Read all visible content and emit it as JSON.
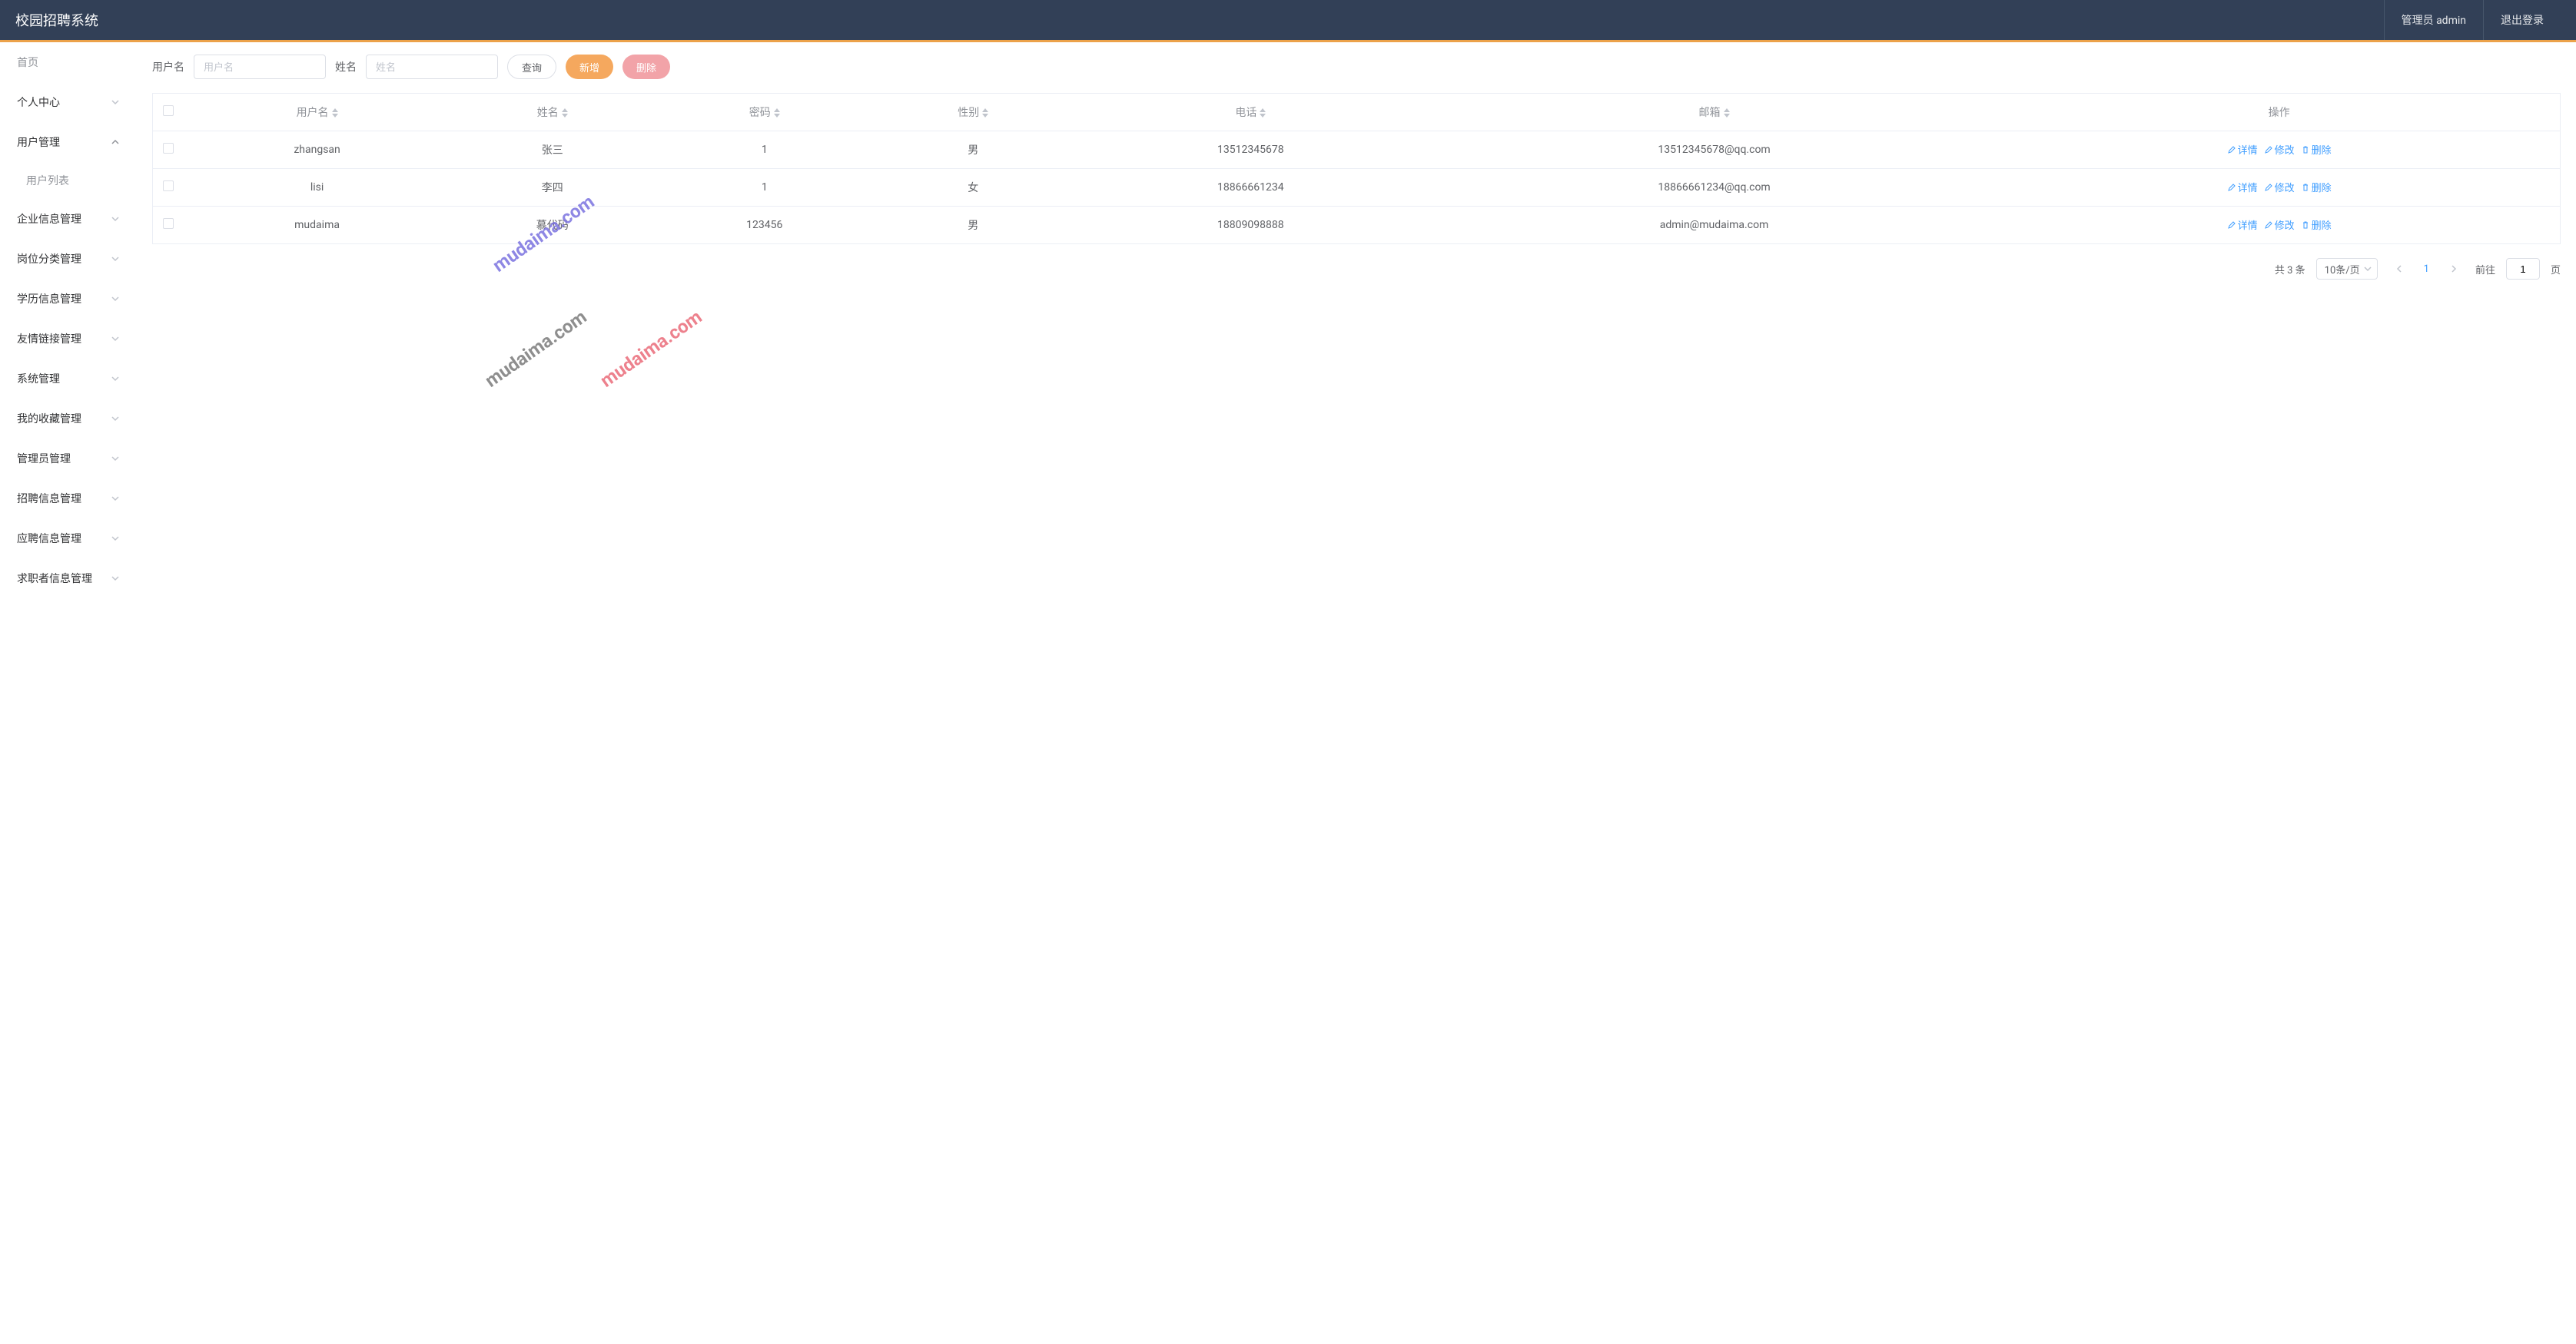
{
  "header": {
    "title": "校园招聘系统",
    "admin_label": "管理员 admin",
    "logout_label": "退出登录"
  },
  "sidebar": {
    "home_label": "首页",
    "groups": [
      {
        "label": "个人中心",
        "expanded": false
      },
      {
        "label": "用户管理",
        "expanded": true,
        "children": [
          {
            "label": "用户列表"
          }
        ]
      },
      {
        "label": "企业信息管理",
        "expanded": false
      },
      {
        "label": "岗位分类管理",
        "expanded": false
      },
      {
        "label": "学历信息管理",
        "expanded": false
      },
      {
        "label": "友情链接管理",
        "expanded": false
      },
      {
        "label": "系统管理",
        "expanded": false
      },
      {
        "label": "我的收藏管理",
        "expanded": false
      },
      {
        "label": "管理员管理",
        "expanded": false
      },
      {
        "label": "招聘信息管理",
        "expanded": false
      },
      {
        "label": "应聘信息管理",
        "expanded": false
      },
      {
        "label": "求职者信息管理",
        "expanded": false
      }
    ]
  },
  "filter": {
    "username_label": "用户名",
    "username_placeholder": "用户名",
    "name_label": "姓名",
    "name_placeholder": "姓名",
    "search_label": "查询",
    "add_label": "新增",
    "delete_label": "删除"
  },
  "table": {
    "columns": {
      "username": "用户名",
      "name": "姓名",
      "password": "密码",
      "gender": "性别",
      "phone": "电话",
      "email": "邮箱",
      "actions": "操作"
    },
    "action_labels": {
      "detail": "详情",
      "edit": "修改",
      "delete": "删除"
    },
    "rows": [
      {
        "username": "zhangsan",
        "name": "张三",
        "password": "1",
        "gender": "男",
        "phone": "13512345678",
        "email": "13512345678@qq.com"
      },
      {
        "username": "lisi",
        "name": "李四",
        "password": "1",
        "gender": "女",
        "phone": "18866661234",
        "email": "18866661234@qq.com"
      },
      {
        "username": "mudaima",
        "name": "慕代码",
        "password": "123456",
        "gender": "男",
        "phone": "18809098888",
        "email": "admin@mudaima.com"
      }
    ]
  },
  "pagination": {
    "total_label": "共 3 条",
    "page_size_label": "10条/页",
    "current_page": "1",
    "goto_label": "前往",
    "goto_value": "1",
    "page_suffix": "页"
  },
  "watermark": {
    "text": "mudaima.com"
  }
}
